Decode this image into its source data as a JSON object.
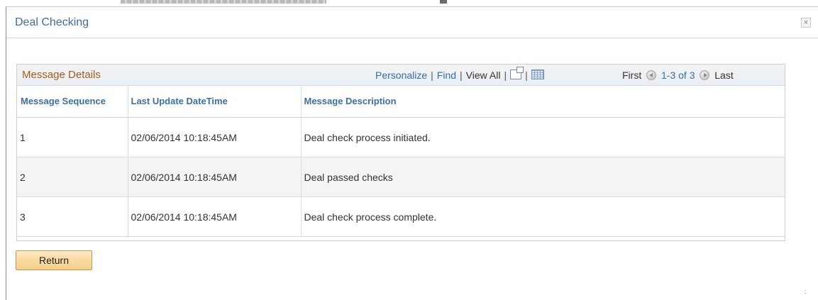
{
  "dialog": {
    "title": "Deal Checking",
    "close_label": "×"
  },
  "grid": {
    "title": "Message Details",
    "links": {
      "personalize": "Personalize",
      "find": "Find",
      "view_all": "View All",
      "separator": "|"
    },
    "pager": {
      "first": "First",
      "range": "1-3 of 3",
      "last": "Last"
    },
    "columns": [
      "Message Sequence",
      "Last Update DateTime",
      "Message Description"
    ],
    "rows": [
      {
        "seq": "1",
        "datetime": "02/06/2014 10:18:45AM",
        "description": "Deal check process initiated."
      },
      {
        "seq": "2",
        "datetime": "02/06/2014 10:18:45AM",
        "description": "Deal passed checks"
      },
      {
        "seq": "3",
        "datetime": "02/06/2014 10:18:45AM",
        "description": "Deal check process complete."
      }
    ]
  },
  "actions": {
    "return_label": "Return"
  },
  "colors": {
    "title_blue": "#3a6fa8",
    "grid_title_orange": "#a65c1c",
    "link_blue": "#2f6fb3",
    "button_fill": "#f5cf86"
  },
  "icons": {
    "close": "close-icon",
    "zoom": "zoom-grid-icon",
    "download": "download-spreadsheet-icon",
    "prev": "previous-arrow-icon",
    "next": "next-arrow-icon",
    "resize": "resize-grip-icon"
  }
}
